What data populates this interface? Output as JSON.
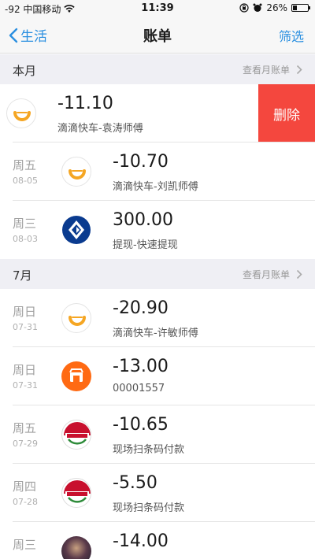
{
  "status_bar": {
    "carrier": "-92 中国移动",
    "time": "11:39",
    "battery": "26%",
    "battery_level": 0.26
  },
  "nav": {
    "back_label": "生活",
    "title": "账单",
    "filter_label": "筛选"
  },
  "sections": [
    {
      "title": "本月",
      "link_label": "查看月账单"
    },
    {
      "title": "7月",
      "link_label": "查看月账单"
    }
  ],
  "swipe_row": {
    "amount": "-11.10",
    "desc": "滴滴快车-袁涛师傅",
    "icon": "didi-icon",
    "delete_label": "删除"
  },
  "rows": [
    {
      "day": "周五",
      "date": "08-05",
      "amount": "-10.70",
      "desc": "滴滴快车-刘凯师傅",
      "icon": "didi-icon"
    },
    {
      "day": "周三",
      "date": "08-03",
      "amount": "300.00",
      "desc": "提现-快速提现",
      "icon": "bank-icon"
    },
    {
      "day": "周日",
      "date": "07-31",
      "amount": "-20.90",
      "desc": "滴滴快车-许敏师傅",
      "icon": "didi-icon"
    },
    {
      "day": "周日",
      "date": "07-31",
      "amount": "-13.00",
      "desc": "00001557",
      "icon": "shop-icon"
    },
    {
      "day": "周五",
      "date": "07-29",
      "amount": "-10.65",
      "desc": "现场扫条码付款",
      "icon": "store-logo-icon"
    },
    {
      "day": "周四",
      "date": "07-28",
      "amount": "-5.50",
      "desc": "现场扫条码付款",
      "icon": "store-logo-icon"
    },
    {
      "day": "周三",
      "date": "",
      "amount": "-14.00",
      "desc": "",
      "icon": "avatar-photo-icon"
    }
  ],
  "colors": {
    "accent": "#2a8fe0",
    "delete": "#f4473e",
    "section_bg": "#efeff4"
  }
}
